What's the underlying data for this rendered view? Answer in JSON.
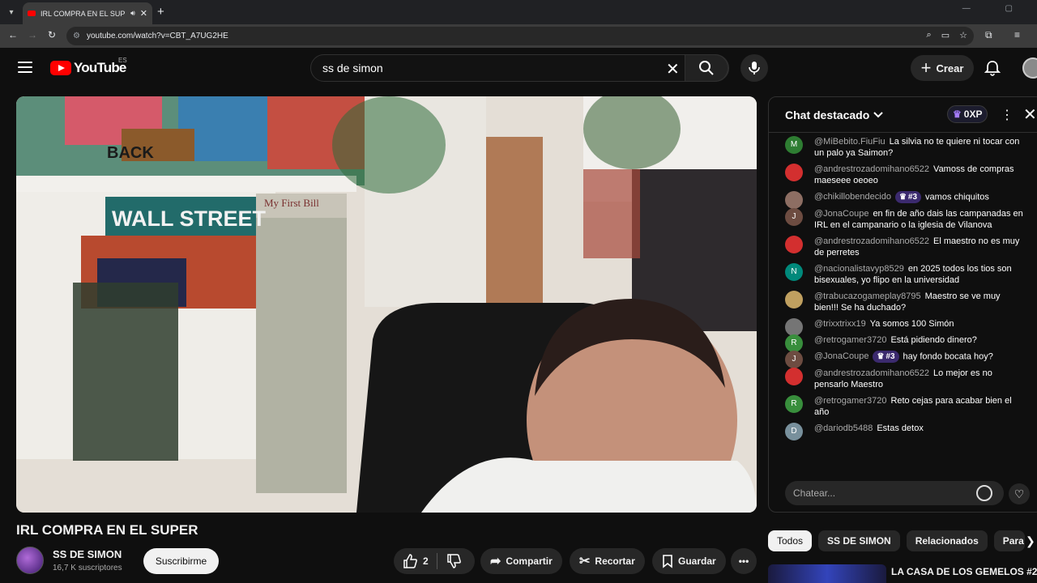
{
  "browser": {
    "tab_title": "IRL COMPRA EN EL SUPER",
    "url": "youtube.com/watch?v=CBT_A7UG2HE"
  },
  "youtube": {
    "logo_text": "YouTube",
    "country_code": "ES",
    "search_value": "ss de simon",
    "create_label": "Crear"
  },
  "video": {
    "title": "IRL COMPRA EN EL SUPER",
    "channel": "SS DE SIMON",
    "subscribers": "16,7 K suscriptores",
    "subscribe_label": "Suscribirme",
    "likes": "2",
    "share_label": "Compartir",
    "clip_label": "Recortar",
    "save_label": "Guardar",
    "poster_texts": {
      "wall_street": "WALL STREET",
      "back": "BACK",
      "first_bill": "My First Bill"
    }
  },
  "chat": {
    "title": "Chat destacado",
    "xp": "0XP",
    "input_placeholder": "Chatear...",
    "messages": [
      {
        "author": "@MiBebito.FiuFiu",
        "badge": "",
        "text": "La silvia no te quiere ni tocar con un palo ya Saimon?",
        "avatar_letter": "M",
        "avatar_color": "#2e7d32"
      },
      {
        "author": "@andrestrozadomihano6522",
        "badge": "",
        "text": "Vamoss de compras maeseee oeoeo",
        "avatar_letter": "",
        "avatar_color": "#d32f2f"
      },
      {
        "author": "@chikillobendecido",
        "badge": "#3",
        "text": "vamos chiquitos",
        "avatar_letter": "",
        "avatar_color": "#8d6e63"
      },
      {
        "author": "@JonaCoupe",
        "badge": "",
        "text": "en fin de año dais las campanadas en IRL en el campanario o la iglesia de Vilanova",
        "avatar_letter": "J",
        "avatar_color": "#6d4c41"
      },
      {
        "author": "@andrestrozadomihano6522",
        "badge": "",
        "text": "El maestro no es muy de perretes",
        "avatar_letter": "",
        "avatar_color": "#d32f2f"
      },
      {
        "author": "@nacionalistavyp8529",
        "badge": "",
        "text": "en 2025 todos los tios son bisexuales, yo flipo en la universidad",
        "avatar_letter": "N",
        "avatar_color": "#00897b"
      },
      {
        "author": "@trabucazogameplay8795",
        "badge": "",
        "text": "Maestro se ve muy bien!!! Se ha duchado?",
        "avatar_letter": "",
        "avatar_color": "#c0a060"
      },
      {
        "author": "@trixxtrixx19",
        "badge": "",
        "text": "Ya somos 100 Simón",
        "avatar_letter": "",
        "avatar_color": "#757575"
      },
      {
        "author": "@retrogamer3720",
        "badge": "",
        "text": "Está pidiendo dinero?",
        "avatar_letter": "R",
        "avatar_color": "#388e3c"
      },
      {
        "author": "@JonaCoupe",
        "badge": "#3",
        "text": "hay fondo bocata hoy?",
        "avatar_letter": "J",
        "avatar_color": "#6d4c41"
      },
      {
        "author": "@andrestrozadomihano6522",
        "badge": "",
        "text": "Lo mejor es no pensarlo Maestro",
        "avatar_letter": "",
        "avatar_color": "#d32f2f"
      },
      {
        "author": "@retrogamer3720",
        "badge": "",
        "text": "Reto cejas para acabar bien el año",
        "avatar_letter": "R",
        "avatar_color": "#388e3c"
      },
      {
        "author": "@dariodb5488",
        "badge": "",
        "text": "Estas detox",
        "avatar_letter": "D",
        "avatar_color": "#78909c"
      }
    ]
  },
  "chips": [
    "Todos",
    "SS DE SIMON",
    "Relacionados",
    "Para"
  ],
  "related": {
    "first_title": "LA CASA DE LOS GEMELOS #2 |"
  }
}
